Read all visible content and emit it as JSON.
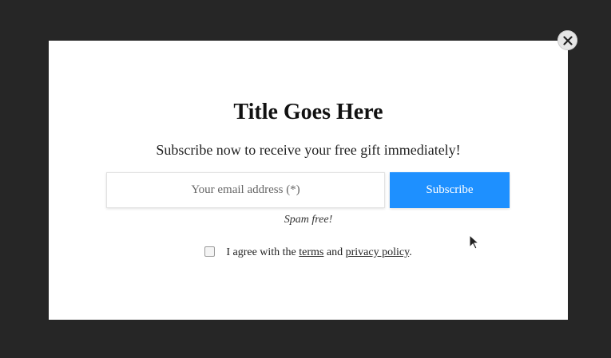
{
  "modal": {
    "title": "Title Goes Here",
    "subtitle": "Subscribe now to receive your free gift immediately!",
    "email_placeholder": "Your email address (*)",
    "subscribe_label": "Subscribe",
    "spam_note": "Spam free!",
    "agree": {
      "prefix": "I agree with the",
      "terms_link": "terms",
      "conjunction": "and",
      "privacy_link": "privacy policy",
      "suffix": "."
    },
    "checkbox_checked": false
  },
  "icons": {
    "close": "close-icon",
    "cursor": "mouse-pointer-icon"
  },
  "colors": {
    "overlay_background": "#262626",
    "modal_background": "#ffffff",
    "subscribe_button": "#1e90ff",
    "close_button": "#e6e6e6"
  }
}
